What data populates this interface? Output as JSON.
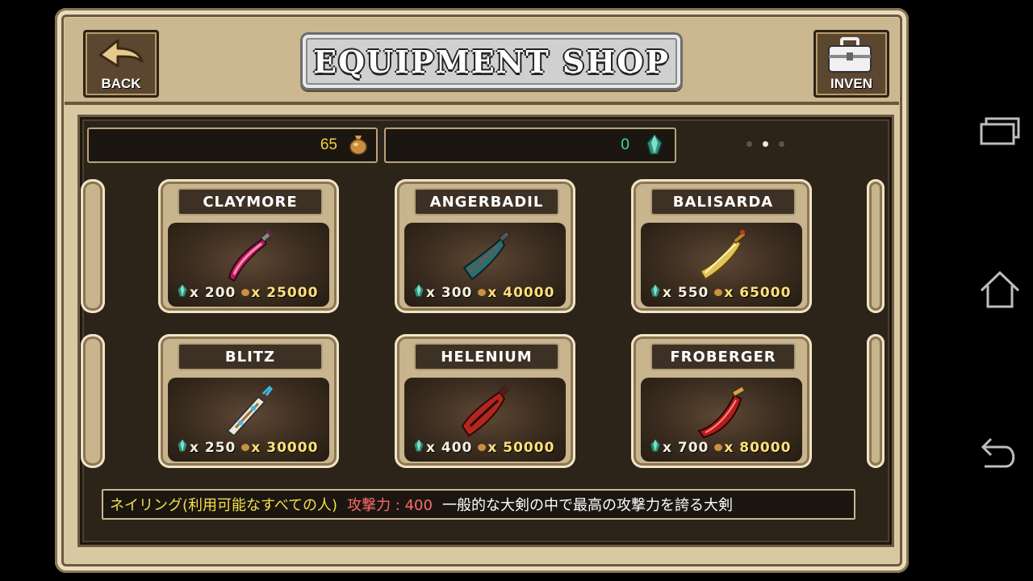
{
  "header": {
    "title": "EQUIPMENT SHOP",
    "back_label": "BACK",
    "inven_label": "INVEN"
  },
  "currency": {
    "gold": "65",
    "crystal": "0"
  },
  "pager": {
    "pages": 3,
    "current_page": 2
  },
  "items": [
    {
      "name": "CLAYMORE",
      "crystal": "x 200",
      "gold": "x 25000",
      "color": "#c2185b"
    },
    {
      "name": "ANGERBADIL",
      "crystal": "x 300",
      "gold": "x 40000",
      "color": "#2f6d6d"
    },
    {
      "name": "BALISARDA",
      "crystal": "x 550",
      "gold": "x 65000",
      "color": "#e2c45a"
    },
    {
      "name": "BLITZ",
      "crystal": "x 250",
      "gold": "x 30000",
      "color": "#d8d4c8"
    },
    {
      "name": "HELENIUM",
      "crystal": "x 400",
      "gold": "x 50000",
      "color": "#b3261e"
    },
    {
      "name": "FROBERGER",
      "crystal": "x 700",
      "gold": "x 80000",
      "color": "#b71c1c"
    }
  ],
  "description": {
    "name": "ネイリング(利用可能なすべての人)",
    "stat_label": "攻撃力 : 400",
    "text": "一般的な大剣の中で最高の攻撃力を誇る大剣"
  },
  "colors": {
    "gold_text": "#f3d23c",
    "crystal_text": "#3fd6c0",
    "stat_text": "#ff6b6b",
    "name_text": "#f4e04a"
  },
  "icons": {
    "back": "back-arrow-icon",
    "inven": "briefcase-icon",
    "gold": "money-bag-icon",
    "crystal": "crystal-icon",
    "nav_recents": "recent-apps-icon",
    "nav_home": "home-icon",
    "nav_back": "nav-back-icon"
  }
}
